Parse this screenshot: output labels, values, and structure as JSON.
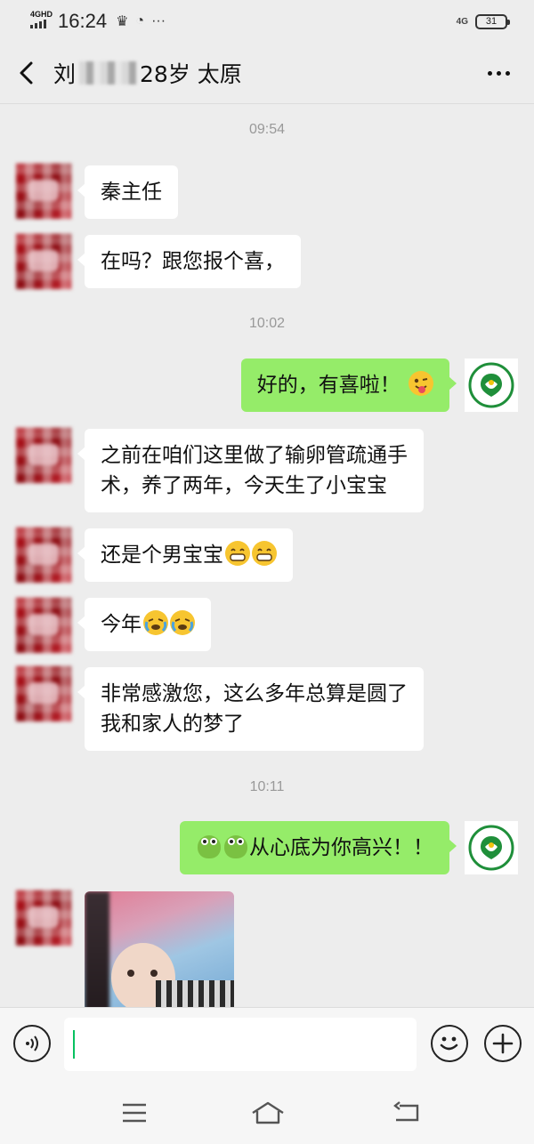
{
  "status_bar": {
    "network": "4GHD",
    "time": "16:24",
    "extra_icons": [
      "crown-icon",
      "privacy-icon",
      "more-dots"
    ],
    "network_right": "4G",
    "battery": "31"
  },
  "header": {
    "name_prefix": "刘",
    "name_suffix": "28岁 太原"
  },
  "chat": {
    "timestamps": [
      "09:54",
      "10:02",
      "10:11"
    ],
    "messages": {
      "m1": "秦主任",
      "m2": "在吗？跟您报个喜，",
      "m3": "好的，有喜啦！",
      "m4_line1": "之前在咱们这里做了输卵管疏通手",
      "m4_line2": "术，养了两年，今天生了小宝宝",
      "m5": "还是个男宝宝",
      "m6": "今年",
      "m7_line1": "非常感激您，这么多年总算是圆了",
      "m7_line2": "我和家人的梦了",
      "m8": "从心底为你高兴！！"
    }
  },
  "colors": {
    "sent_bubble": "#95ec69",
    "received_bubble": "#ffffff",
    "background": "#ededed",
    "caret": "#07c160"
  }
}
